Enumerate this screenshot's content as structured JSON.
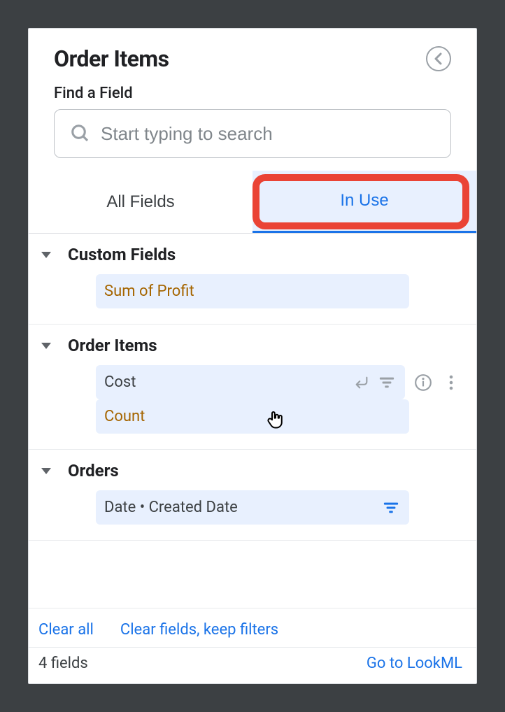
{
  "header": {
    "title": "Order Items"
  },
  "search": {
    "label": "Find a Field",
    "placeholder": "Start typing to search"
  },
  "tabs": {
    "all": "All Fields",
    "in_use": "In Use"
  },
  "sections": [
    {
      "name": "Custom Fields",
      "fields": [
        {
          "label": "Sum of Profit",
          "kind": "measure"
        }
      ]
    },
    {
      "name": "Order Items",
      "fields": [
        {
          "label": "Cost",
          "kind": "dimension",
          "hovered": true
        },
        {
          "label": "Count",
          "kind": "measure"
        }
      ]
    },
    {
      "name": "Orders",
      "fields": [
        {
          "label": "Date • Created Date",
          "kind": "dimension",
          "filtered": true
        }
      ]
    }
  ],
  "clear": {
    "all": "Clear all",
    "keep_filters": "Clear fields, keep filters"
  },
  "footer": {
    "count": "4 fields",
    "lookml": "Go to LookML"
  }
}
